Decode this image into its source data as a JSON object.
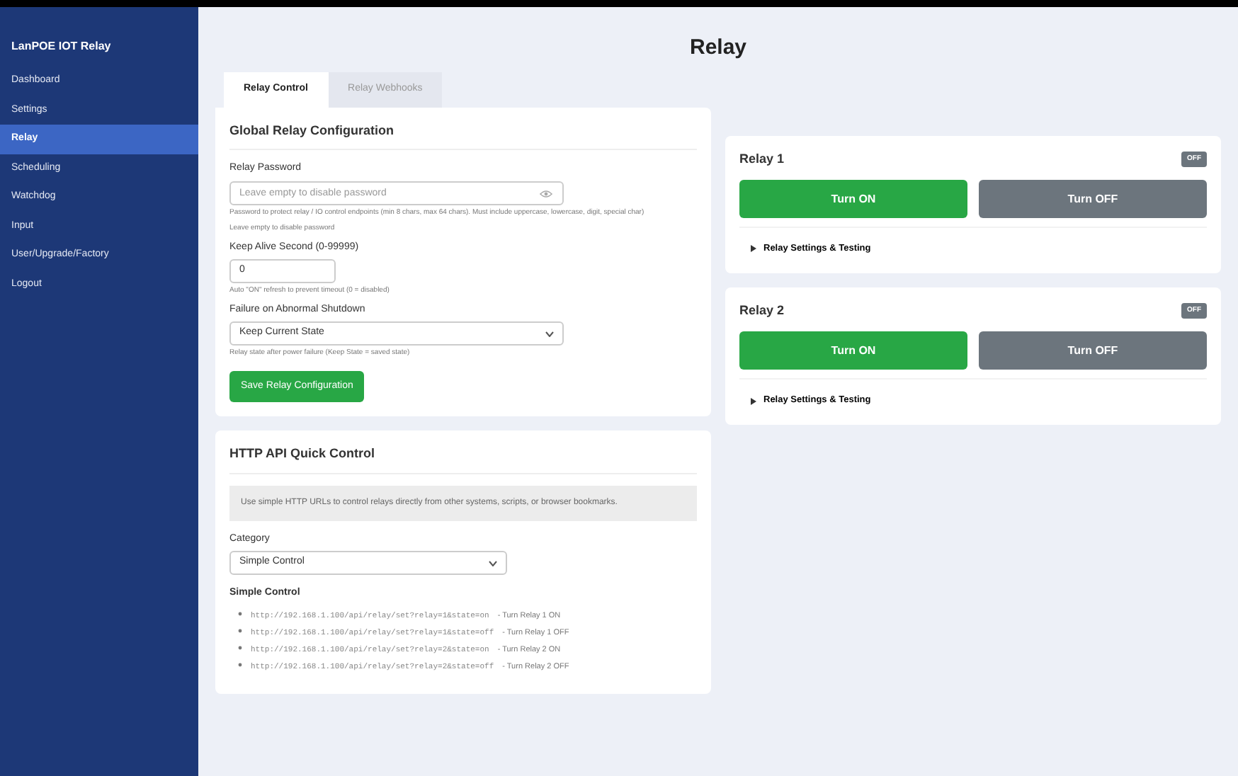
{
  "sidebar": {
    "title": "LanPOE IOT Relay",
    "items": [
      {
        "label": "Dashboard",
        "selected": false
      },
      {
        "label": "Settings",
        "selected": false
      },
      {
        "label": "Relay",
        "selected": true
      },
      {
        "label": "Scheduling",
        "selected": false
      },
      {
        "label": "Watchdog",
        "selected": false
      },
      {
        "label": "Input",
        "selected": false
      },
      {
        "label": "User/Upgrade/Factory",
        "selected": false
      },
      {
        "label": "Logout",
        "selected": false
      }
    ]
  },
  "page_title": "Relay",
  "tabs": [
    {
      "label": "Relay Control",
      "selected": true
    },
    {
      "label": "Relay Webhooks",
      "selected": false
    }
  ],
  "global_config": {
    "title": "Global Relay Configuration",
    "password": {
      "label": "Relay Password",
      "placeholder": "Leave empty to disable password",
      "help": "Password to protect relay / IO control endpoints (min 8 chars, max 64 chars). Must include uppercase, lowercase, digit, special char)",
      "note": "Leave empty to disable password"
    },
    "keep_alive": {
      "label": "Keep Alive Second (0-99999)",
      "value": "0",
      "help": "Auto \"ON\" refresh to prevent timeout (0 = disabled)"
    },
    "failure": {
      "label": "Failure on Abnormal Shutdown",
      "value": "Keep Current State",
      "help": "Relay state after power failure (Keep State = saved state)"
    },
    "save_button": "Save Relay Configuration"
  },
  "api": {
    "title": "HTTP API Quick Control",
    "info": "Use simple HTTP URLs to control relays directly from other systems, scripts, or browser bookmarks.",
    "category_label": "Category",
    "category_value": "Simple Control",
    "section_title": "Simple Control",
    "urls": [
      {
        "url": "http://192.168.1.100/api/relay/set?relay=1&state=on",
        "desc": "- Turn Relay 1 ON"
      },
      {
        "url": "http://192.168.1.100/api/relay/set?relay=1&state=off",
        "desc": "- Turn Relay 1 OFF"
      },
      {
        "url": "http://192.168.1.100/api/relay/set?relay=2&state=on",
        "desc": "- Turn Relay 2 ON"
      },
      {
        "url": "http://192.168.1.100/api/relay/set?relay=2&state=off",
        "desc": "- Turn Relay 2 OFF"
      }
    ]
  },
  "relays": [
    {
      "name": "Relay 1",
      "status": "OFF",
      "on_button": "Turn ON",
      "off_button": "Turn OFF",
      "settings": "Relay Settings & Testing",
      "expanded": false
    },
    {
      "name": "Relay 2",
      "status": "OFF",
      "on_button": "Turn ON",
      "off_button": "Turn OFF",
      "settings": "Relay Settings & Testing",
      "expanded": false
    }
  ]
}
